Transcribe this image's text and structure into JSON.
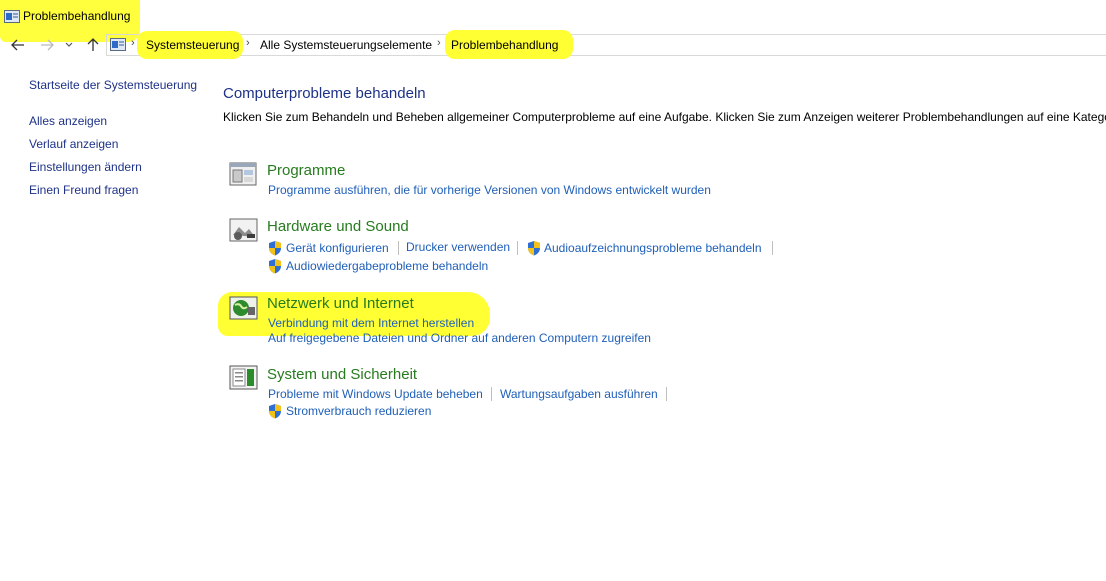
{
  "window": {
    "title": "Problembehandlung"
  },
  "navigation": {
    "back_icon": "arrow-left-icon",
    "forward_icon": "arrow-right-icon",
    "recent_icon": "chevron-down-icon",
    "up_icon": "arrow-up-icon",
    "breadcrumbs": [
      "Systemsteuerung",
      "Alle Systemsteuerungselemente",
      "Problembehandlung"
    ]
  },
  "sidebar": {
    "home": "Startseite der Systemsteuerung",
    "items": [
      {
        "label": "Alles anzeigen"
      },
      {
        "label": "Verlauf anzeigen"
      },
      {
        "label": "Einstellungen ändern"
      },
      {
        "label": "Einen Freund fragen"
      }
    ]
  },
  "main": {
    "title": "Computerprobleme behandeln",
    "description": "Klicken Sie zum Behandeln und Beheben allgemeiner Computerprobleme auf eine Aufgabe. Klicken Sie zum Anzeigen weiterer Problembehandlungen auf eine Kategorie",
    "categories": [
      {
        "title": "Programme",
        "icon": "programs-icon",
        "links": [
          "Programme ausführen, die für vorherige Versionen von Windows entwickelt wurden"
        ]
      },
      {
        "title": "Hardware und Sound",
        "icon": "hardware-sound-icon",
        "links": [
          "Gerät konfigurieren",
          "Drucker verwenden",
          "Audioaufzeichnungsprobleme behandeln",
          "Audiowiedergabeprobleme behandeln"
        ]
      },
      {
        "title": "Netzwerk und Internet",
        "icon": "network-globe-icon",
        "links": [
          "Verbindung mit dem Internet herstellen",
          "Auf freigegebene Dateien und Ordner auf anderen Computern zugreifen"
        ]
      },
      {
        "title": "System und Sicherheit",
        "icon": "system-security-icon",
        "links": [
          "Probleme mit Windows Update beheben",
          "Wartungsaufgaben ausführen",
          "Stromverbrauch reduzieren"
        ]
      }
    ]
  },
  "colors": {
    "highlight": "#ffff33",
    "link": "#1f5fb8",
    "category_title": "#267b1e",
    "heading": "#1e3287"
  }
}
